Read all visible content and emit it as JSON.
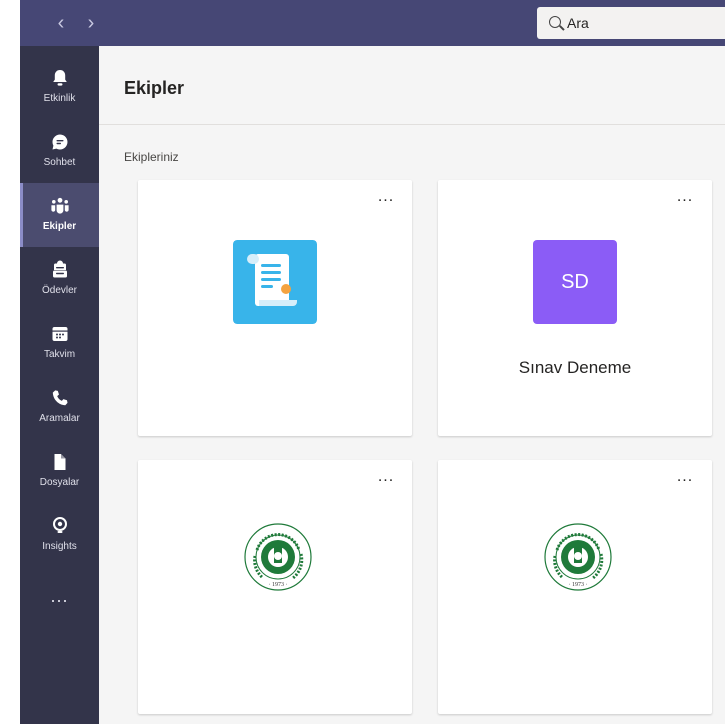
{
  "search": {
    "placeholder": "Ara"
  },
  "rail": {
    "items": [
      {
        "label": "Etkinlik",
        "icon": "bell-icon"
      },
      {
        "label": "Sohbet",
        "icon": "chat-icon"
      },
      {
        "label": "Ekipler",
        "icon": "teams-icon",
        "active": true
      },
      {
        "label": "Ödevler",
        "icon": "assignments-icon"
      },
      {
        "label": "Takvim",
        "icon": "calendar-icon"
      },
      {
        "label": "Aramalar",
        "icon": "phone-icon"
      },
      {
        "label": "Dosyalar",
        "icon": "file-icon"
      },
      {
        "label": "Insights",
        "icon": "insights-icon"
      }
    ],
    "more_label": "..."
  },
  "page": {
    "title": "Ekipler",
    "section_label": "Ekipleriniz"
  },
  "teams": [
    {
      "name": "",
      "icon": "certificate-scroll-icon",
      "more": "..."
    },
    {
      "name": "Sınav Deneme",
      "initials": "SD",
      "avatar_color": "#8b5cf6",
      "more": "..."
    },
    {
      "name": "",
      "icon": "university-seal-logo",
      "more": "..."
    },
    {
      "name": "",
      "icon": "university-seal-logo",
      "more": "..."
    }
  ],
  "logo_text": {
    "university": "ÇUKUROVA ÜNİVERSİTESİ",
    "year": "1973"
  },
  "colors": {
    "titlebar": "#464775",
    "rail": "#33344a",
    "accent": "#8b5cf6"
  }
}
